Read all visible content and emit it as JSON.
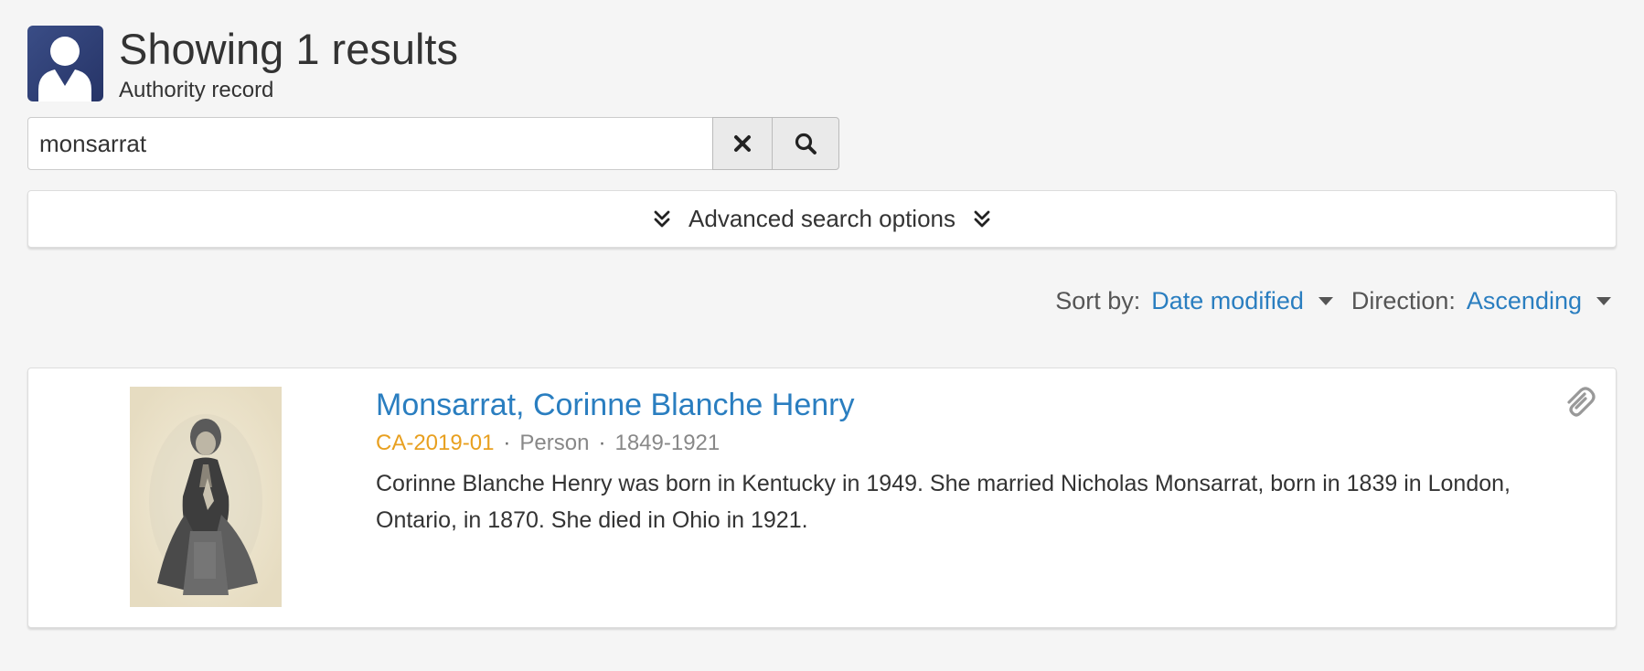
{
  "header": {
    "title": "Showing 1 results",
    "subtitle": "Authority record",
    "icon": "person-icon"
  },
  "search": {
    "value": "monsarrat",
    "clear_icon": "close-icon",
    "submit_icon": "search-icon"
  },
  "advanced": {
    "label": "Advanced search options",
    "icon": "double-chevron-down-icon"
  },
  "sort": {
    "sort_label": "Sort by:",
    "sort_value": "Date modified",
    "direction_label": "Direction:",
    "direction_value": "Ascending"
  },
  "results": [
    {
      "title": "Monsarrat, Corinne Blanche Henry",
      "identifier": "CA-2019-01",
      "entity_type": "Person",
      "dates": "1849-1921",
      "description": "Corinne Blanche Henry was born in Kentucky in 1949. She married Nicholas Monsarrat, born in 1839 in London, Ontario, in 1870. She died in Ohio in 1921.",
      "clipboard_icon": "paperclip-icon"
    }
  ],
  "colors": {
    "link": "#2a7ec0",
    "identifier": "#e8a020",
    "icon_bg": "#2e3f75",
    "background": "#f5f5f5"
  }
}
